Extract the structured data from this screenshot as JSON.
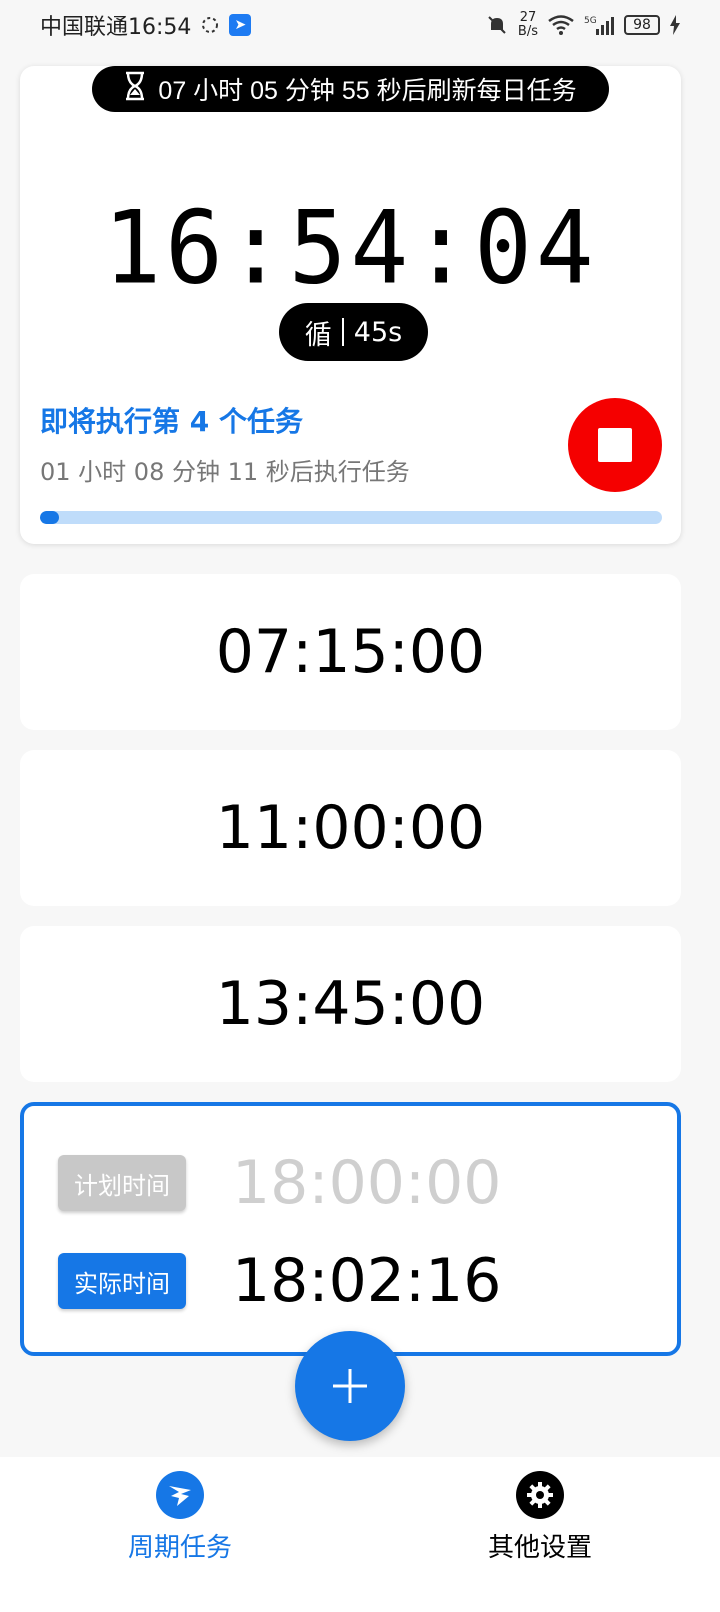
{
  "status_bar": {
    "carrier_time": "中国联通16:54",
    "net_rate_value": "27",
    "net_rate_unit": "B/s",
    "battery": "98"
  },
  "top_card": {
    "refresh_text": "07 小时 05 分钟 55 秒后刷新每日任务",
    "clock": "16:54:04",
    "cycle_glyph": "循",
    "cycle_value": "45s",
    "next_task_title": "即将执行第 4 个任务",
    "next_task_countdown": "01 小时 08 分钟 11 秒后执行任务",
    "progress_fraction": 0.03
  },
  "tasks": [
    {
      "time": "07:15:00"
    },
    {
      "time": "11:00:00"
    },
    {
      "time": "13:45:00"
    }
  ],
  "selected_task": {
    "planned_label": "计划时间",
    "planned_time": "18:00:00",
    "actual_label": "实际时间",
    "actual_time": "18:02:16"
  },
  "colors": {
    "accent": "#1677e6",
    "stop": "#f50000",
    "progress_track": "#bfdcfa"
  },
  "nav": {
    "periodic_label": "周期任务",
    "settings_label": "其他设置"
  }
}
